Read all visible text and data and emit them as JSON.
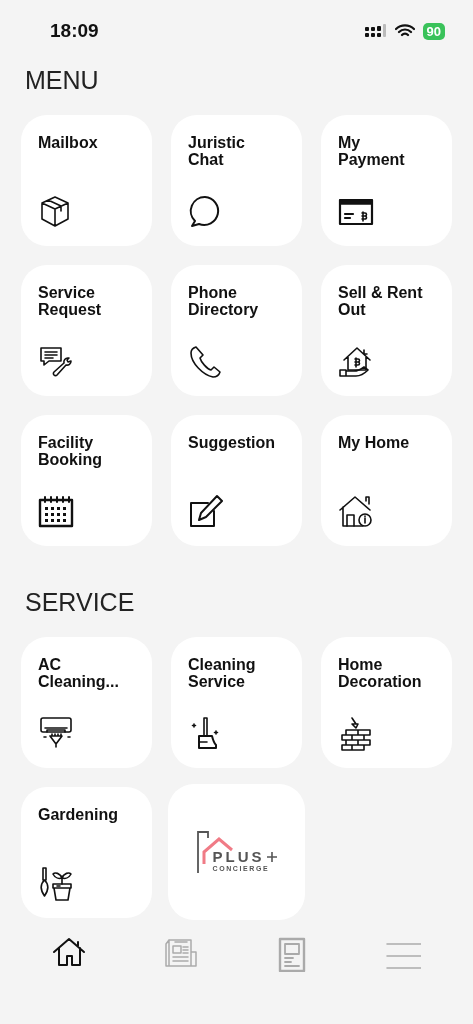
{
  "status_bar": {
    "time": "18:09",
    "battery": "90"
  },
  "sections": [
    {
      "title": "MENU",
      "items": [
        {
          "kind": "menu",
          "label": "Mailbox"
        },
        {
          "kind": "menu",
          "label": "Juristic Chat"
        },
        {
          "kind": "menu",
          "label": "My Payment"
        },
        {
          "kind": "menu",
          "label": "Service Request"
        },
        {
          "kind": "menu",
          "label": "Phone Directory"
        },
        {
          "kind": "menu",
          "label": "Sell & Rent Out"
        },
        {
          "kind": "menu",
          "label": "Facility Booking"
        },
        {
          "kind": "menu",
          "label": "Suggestion"
        },
        {
          "kind": "menu",
          "label": "My Home"
        }
      ]
    },
    {
      "title": "SERVICE",
      "items": [
        {
          "kind": "menu",
          "label": "AC Cleaning..."
        },
        {
          "kind": "menu",
          "label": "Cleaning Service"
        },
        {
          "kind": "menu",
          "label": "Home Decoration"
        },
        {
          "kind": "menu",
          "label": "Gardening"
        },
        {
          "kind": "logo",
          "title": "PLUS",
          "subtitle": "CONCIERGE"
        }
      ]
    }
  ],
  "tab_bar": [
    {
      "selected": true
    },
    {
      "selected": false
    },
    {
      "selected": false
    },
    {
      "selected": false
    }
  ]
}
